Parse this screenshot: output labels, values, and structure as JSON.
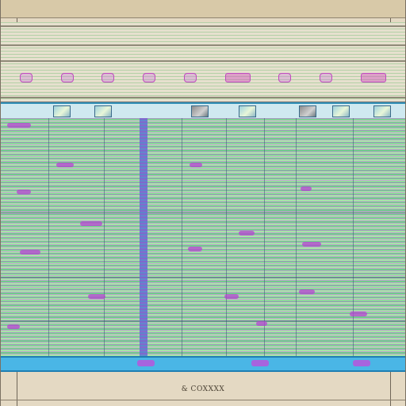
{
  "status_bar": {
    "text": "& COXXXX"
  },
  "toolbar": {
    "icons": [
      "tool-icon",
      "tool-icon",
      "tool-icon",
      "tool-icon",
      "tool-icon",
      "tool-icon",
      "tool-icon",
      "tool-icon",
      "tool-icon"
    ]
  },
  "colors": {
    "accent_magenta": "#c04ac0",
    "grid_green": "#8fd19a",
    "header_blue": "#2f8fb6",
    "footer_blue": "#4ab6e6",
    "frame_tan": "#e4d9c3"
  }
}
